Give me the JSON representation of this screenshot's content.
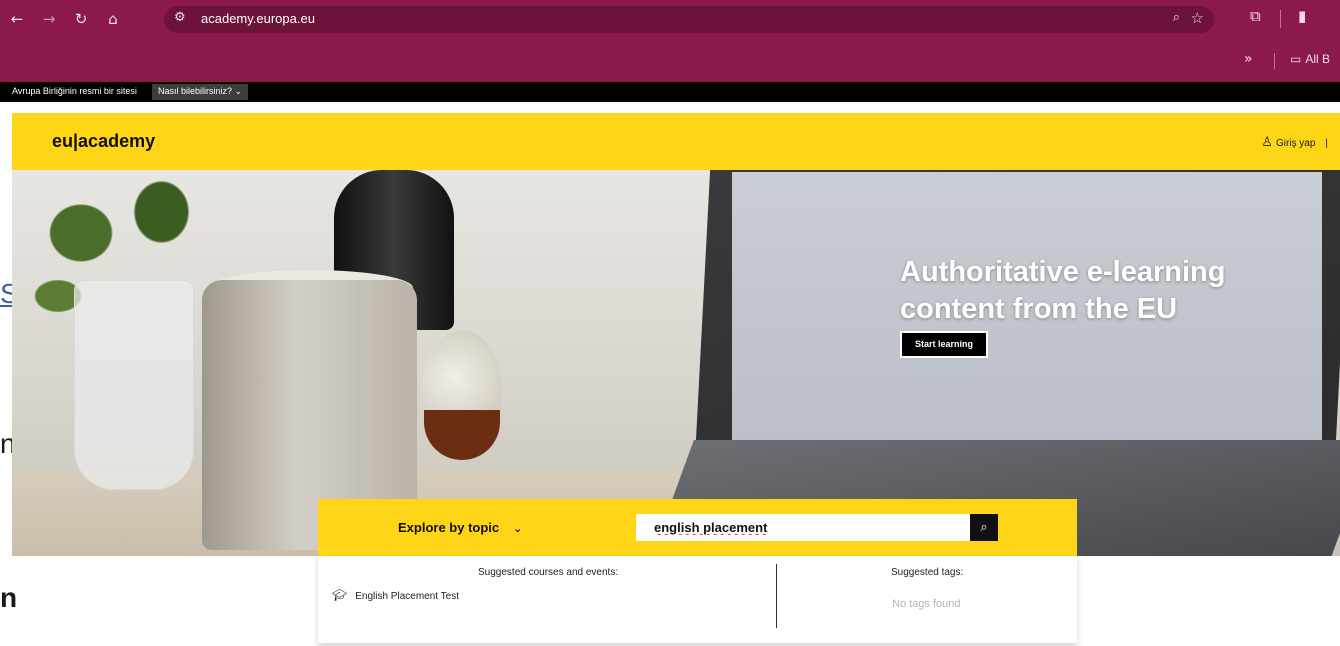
{
  "browser": {
    "url": "academy.europa.eu",
    "bookmarks_more": "»",
    "bookmark_folder": "All B"
  },
  "eu_banner": {
    "official_text": "Avrupa Birliğinin resmi bir sitesi",
    "how_to_know": "Nasıl bilebilirsiniz?"
  },
  "header": {
    "logo": "eu|academy",
    "login": "Giriş yap",
    "separator": "|"
  },
  "hero": {
    "title": "Authoritative e-learning content from the EU",
    "cta": "Start learning"
  },
  "search": {
    "explore_label": "Explore by topic",
    "query": "english placement"
  },
  "suggestions": {
    "courses_title": "Suggested courses and events:",
    "courses": [
      "English Placement Test"
    ],
    "tags_title": "Suggested tags:",
    "tags_empty": "No tags found"
  },
  "background_fragments": [
    "S",
    "n",
    "n"
  ],
  "colors": {
    "browser_chrome": "#8b1a4b",
    "brand_yellow": "#ffd617",
    "black": "#000000"
  }
}
